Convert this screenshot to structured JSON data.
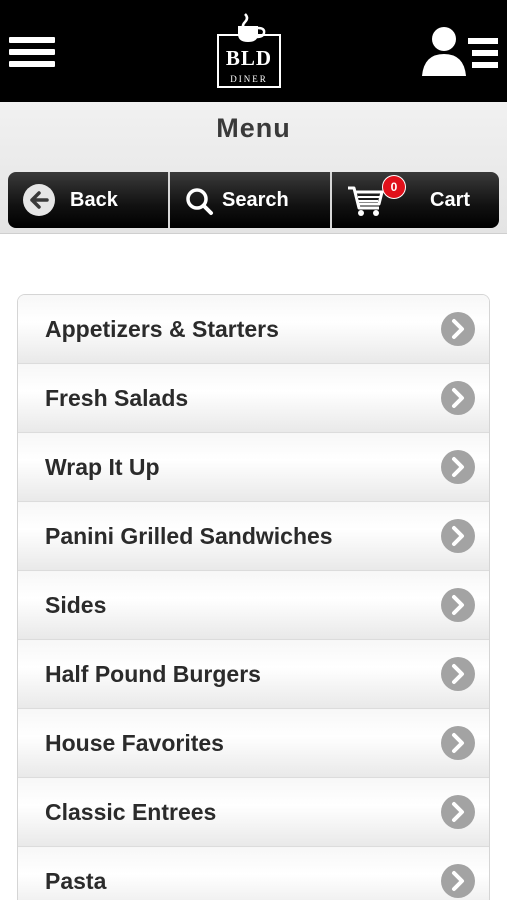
{
  "header": {
    "menu_icon": "hamburger-icon",
    "logo": {
      "main": "BLD",
      "sub": "DINER"
    },
    "account_icon": "user-list-icon"
  },
  "title": "Menu",
  "nav": {
    "back_label": "Back",
    "search_label": "Search",
    "cart_label": "Cart",
    "cart_count": "0",
    "badge_color": "#e0101a"
  },
  "categories": [
    {
      "label": "Appetizers & Starters"
    },
    {
      "label": "Fresh Salads"
    },
    {
      "label": "Wrap It Up"
    },
    {
      "label": "Panini Grilled Sandwiches"
    },
    {
      "label": "Sides"
    },
    {
      "label": "Half Pound Burgers"
    },
    {
      "label": "House Favorites"
    },
    {
      "label": "Classic Entrees"
    },
    {
      "label": "Pasta"
    }
  ]
}
